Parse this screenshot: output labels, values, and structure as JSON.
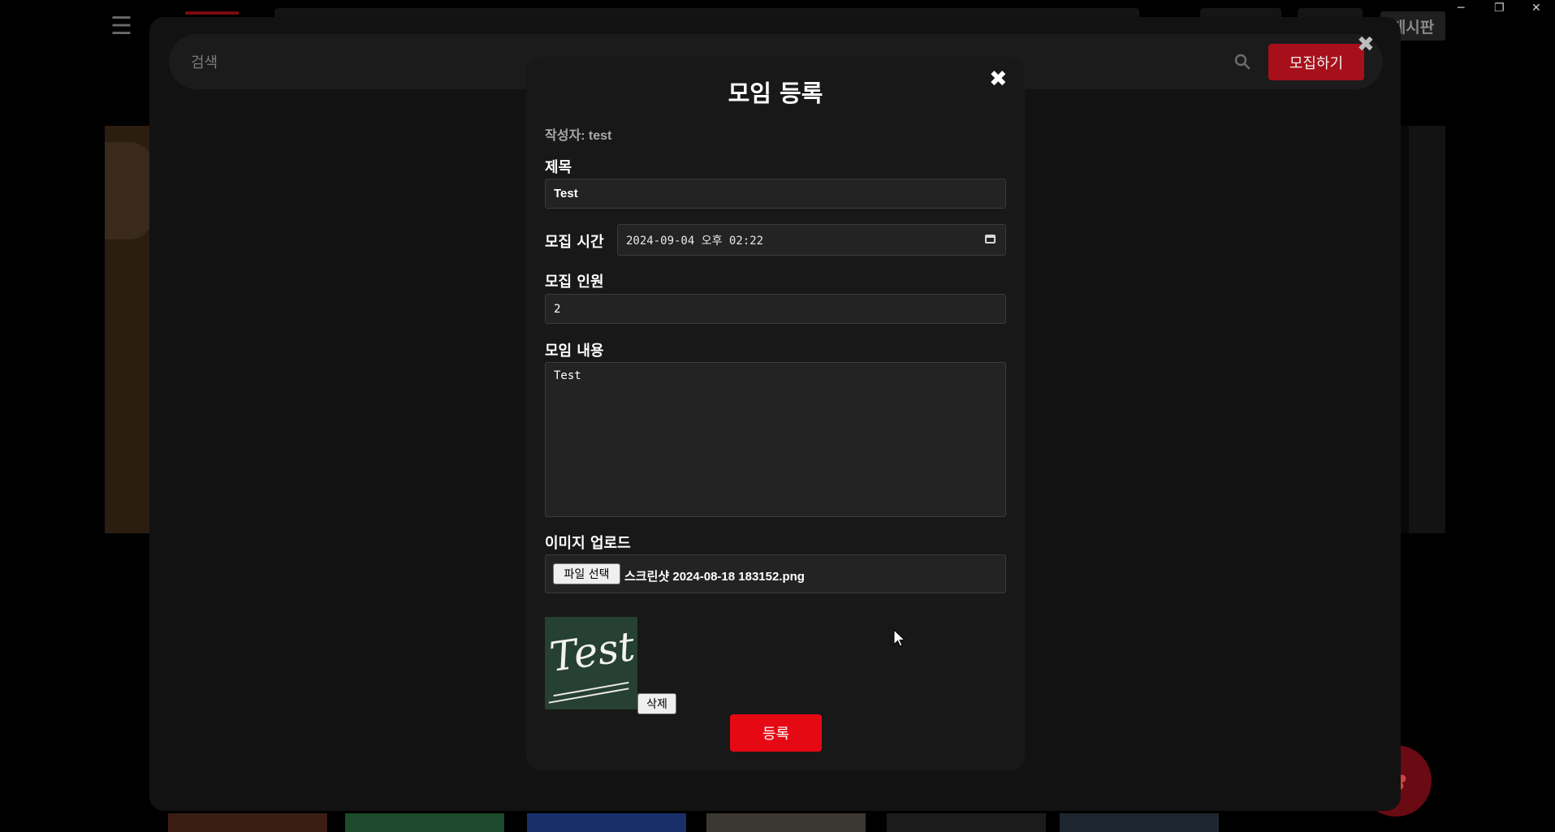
{
  "window": {
    "minimize": "─",
    "restore": "❐",
    "close": "✕"
  },
  "background": {
    "menu_icon": "☰",
    "board_label": "게시판",
    "fab_icon": "paw-icon"
  },
  "search": {
    "placeholder": "검색",
    "recruit_label": "모집하기",
    "close_label": "✖"
  },
  "modal": {
    "title": "모임 등록",
    "close_label": "✖",
    "author": "작성자: test",
    "title_label": "제목",
    "title_value": "Test",
    "time_label": "모집 시간",
    "time_value": "2024-09-04 오후 02:22",
    "people_label": "모집 인원",
    "people_value": "2",
    "content_label": "모임 내용",
    "content_value": "Test",
    "image_label": "이미지 업로드",
    "file_button": "파일 선택",
    "file_name": "스크린샷 2024-08-18 183152.png",
    "preview_text": "Test",
    "delete_label": "삭제",
    "submit_label": "등록"
  },
  "colors": {
    "accent": "#e50914",
    "accent_dark": "#a7101a",
    "modal_bg": "#181818",
    "field_bg": "#232323"
  }
}
